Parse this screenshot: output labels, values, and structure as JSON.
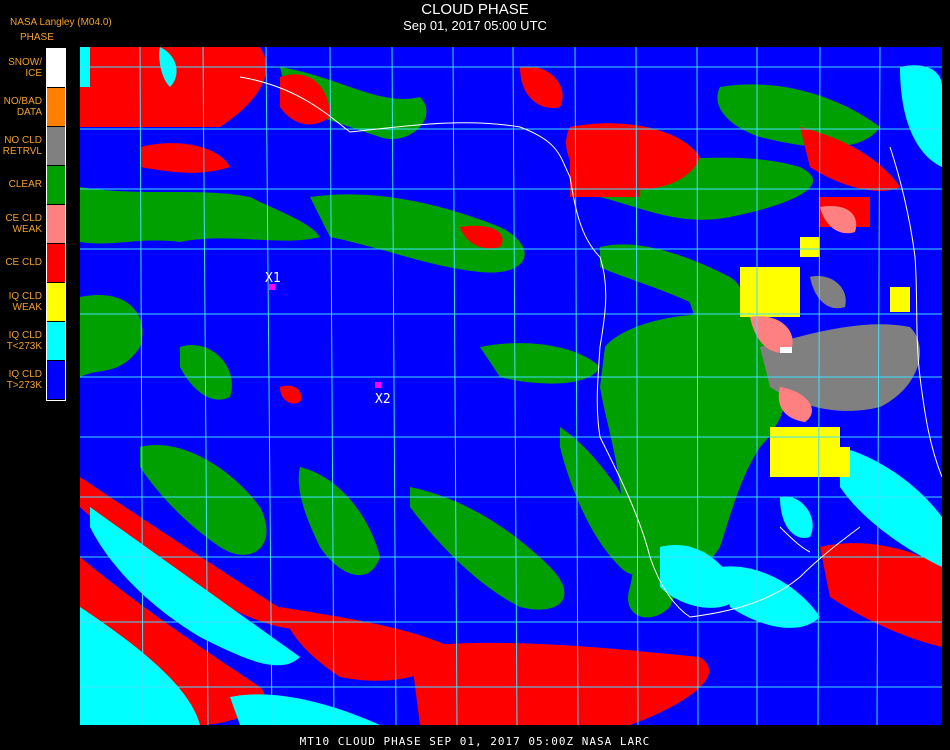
{
  "header": {
    "title": "CLOUD PHASE",
    "subtitle": "Sep 01, 2017 05:00 UTC",
    "provider": "NASA Langley (M04.0)"
  },
  "legend": {
    "title": "PHASE",
    "items": [
      {
        "label_lines": [
          "SNOW/",
          "ICE"
        ],
        "color": "#ffffff"
      },
      {
        "label_lines": [
          "NO/BAD",
          "DATA"
        ],
        "color": "#ff8000"
      },
      {
        "label_lines": [
          "NO CLD",
          "RETRVL"
        ],
        "color": "#808080"
      },
      {
        "label_lines": [
          "CLEAR"
        ],
        "color": "#00a000"
      },
      {
        "label_lines": [
          "CE CLD",
          "WEAK"
        ],
        "color": "#ff8080"
      },
      {
        "label_lines": [
          "CE CLD"
        ],
        "color": "#ff0000"
      },
      {
        "label_lines": [
          "IQ CLD",
          "WEAK"
        ],
        "color": "#ffff00"
      },
      {
        "label_lines": [
          "IQ CLD",
          "T<273K"
        ],
        "color": "#00ffff"
      },
      {
        "label_lines": [
          "IQ CLD",
          "T>273K"
        ],
        "color": "#0000ff"
      }
    ]
  },
  "map": {
    "markers": [
      {
        "label": "X1",
        "color": "#ff00ff"
      },
      {
        "label": "X2",
        "color": "#ff00ff"
      }
    ],
    "grid_color": "#40e0ff",
    "coast_color": "#ffffff"
  },
  "footer": {
    "text": "MT10  CLOUD PHASE   SEP 01, 2017 05:00Z   NASA LARC"
  }
}
